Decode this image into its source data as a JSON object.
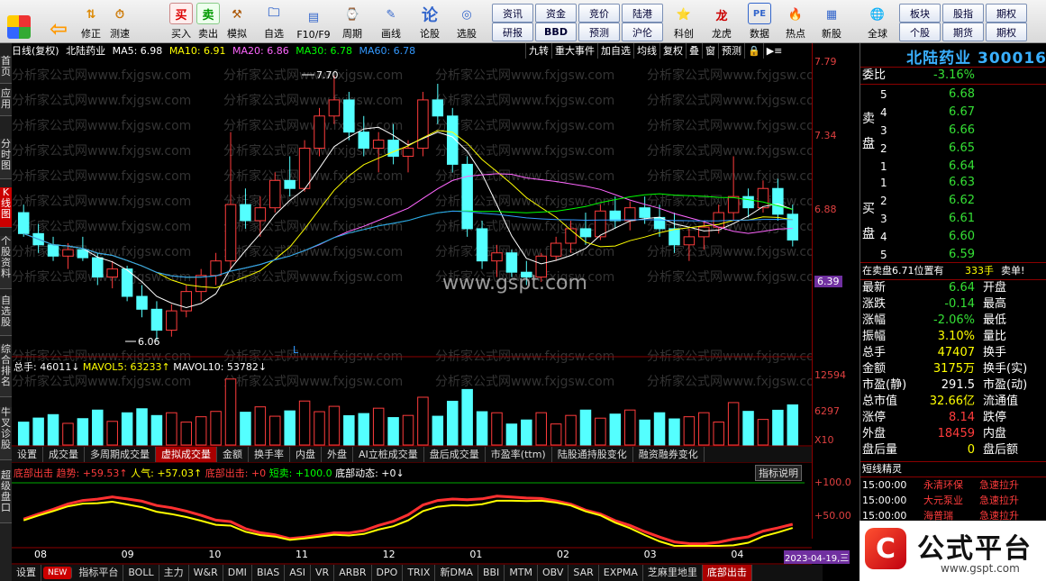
{
  "toolbar": {
    "buttons": [
      {
        "label": "",
        "icon": "grid-icon"
      },
      {
        "label": "",
        "icon": "back-arrow-icon"
      },
      {
        "label": "修正"
      },
      {
        "label": "测速"
      },
      {
        "label": "买入"
      },
      {
        "label": "卖出"
      },
      {
        "label": "模拟"
      },
      {
        "label": "自选"
      },
      {
        "label": "F10/F9"
      },
      {
        "label": "周期"
      },
      {
        "label": "画线"
      },
      {
        "label": "论股"
      },
      {
        "label": "选股"
      }
    ],
    "small_buttons": [
      "资讯",
      "资金",
      "竞价",
      "陆港",
      "研报",
      "BBD",
      "预测",
      "沪伦"
    ],
    "right_buttons": [
      {
        "label": "科创"
      },
      {
        "label": "龙虎"
      },
      {
        "label": "数据"
      },
      {
        "label": "热点"
      },
      {
        "label": "新股"
      },
      {
        "label": "全球"
      }
    ],
    "far_right": [
      "板块",
      "股指",
      "期权",
      "个股",
      "期货",
      "期权"
    ]
  },
  "left_tabs": [
    "首页",
    "应用",
    "分时图",
    "K线图",
    "个股资料",
    "自选股",
    "综合排名",
    "牛叉诊股",
    "超级盘口"
  ],
  "chart": {
    "info_title": "日线(复权)",
    "stock_name": "北陆药业",
    "ma_labels": [
      {
        "text": "MA5: 6.98",
        "color": "#ffffff"
      },
      {
        "text": "MA10: 6.91",
        "color": "#ffff00"
      },
      {
        "text": "MA20: 6.86",
        "color": "#ff66ff"
      },
      {
        "text": "MA30: 6.78",
        "color": "#00ff00"
      },
      {
        "text": "MA60: 6.78",
        "color": "#3399ff"
      }
    ],
    "top_right_tools": [
      "九转",
      "重大事件",
      "加自选",
      "均线",
      "复权",
      "叠",
      "窗",
      "预测"
    ],
    "price_axis": [
      "7.79",
      "7.34",
      "6.88",
      "6.39"
    ],
    "high_mark": "7.70",
    "low_mark": "6.06",
    "current_price_tag": "6.39",
    "watermark": "www.gspt.com",
    "bg_watermark": "分析家公式网www.fxjgsw.com",
    "volume_labels": [
      {
        "text": "总手: 46011↓",
        "color": "#ffffff"
      },
      {
        "text": "MAVOL5: 63233↑",
        "color": "#ffff00"
      },
      {
        "text": "MAVOL10: 53782↓",
        "color": "#ffffff"
      }
    ],
    "volume_axis": [
      "12594",
      "6297",
      "X10"
    ],
    "bottom_tabs": [
      "设置",
      "成交量",
      "多周期成交量",
      "虚拟成交量",
      "金额",
      "换手率",
      "内盘",
      "外盘",
      "AI立桩成交量",
      "盘后成交量",
      "市盈率(ttm)",
      "陆股通持股变化",
      "融资融券变化"
    ],
    "indicator_labels": [
      {
        "text": "底部出击 趋势: +59.53↑",
        "color": "#ff3c3c"
      },
      {
        "text": "人气: +57.03↑",
        "color": "#ffff00"
      },
      {
        "text": "底部出击: +0",
        "color": "#ff3c3c"
      },
      {
        "text": "短卖: +100.0",
        "color": "#00ff00"
      },
      {
        "text": "底部动态: +0↓",
        "color": "#ffffff"
      }
    ],
    "indicator_button": "指标说明",
    "indicator_axis": [
      "+100.0",
      "+50.00"
    ],
    "month_labels": [
      "08",
      "09",
      "10",
      "11",
      "12",
      "01",
      "02",
      "03",
      "04"
    ],
    "date_tag": "2023-04-19,三",
    "indicator_tabs": [
      "设置",
      "NEW",
      "指标平台",
      "BOLL",
      "主力",
      "W&R",
      "DMI",
      "BIAS",
      "ASI",
      "VR",
      "ARBR",
      "DPO",
      "TRIX",
      "新DMA",
      "BBI",
      "MTM",
      "OBV",
      "SAR",
      "EXPMA",
      "芝麻里地里",
      "底部出击"
    ]
  },
  "chart_data": {
    "type": "candlestick",
    "title": "北陆药业",
    "ylim": [
      6.0,
      7.79
    ],
    "candles": [
      [
        6.85,
        6.9,
        6.7,
        6.72
      ],
      [
        6.72,
        6.78,
        6.6,
        6.65
      ],
      [
        6.65,
        6.7,
        6.55,
        6.58
      ],
      [
        6.58,
        6.66,
        6.5,
        6.62
      ],
      [
        6.62,
        6.7,
        6.55,
        6.57
      ],
      [
        6.57,
        6.6,
        6.4,
        6.45
      ],
      [
        6.45,
        6.55,
        6.38,
        6.5
      ],
      [
        6.5,
        6.52,
        6.3,
        6.33
      ],
      [
        6.33,
        6.4,
        6.2,
        6.25
      ],
      [
        6.25,
        6.3,
        6.06,
        6.12
      ],
      [
        6.12,
        6.28,
        6.08,
        6.24
      ],
      [
        6.24,
        6.4,
        6.2,
        6.36
      ],
      [
        6.36,
        6.5,
        6.3,
        6.46
      ],
      [
        6.46,
        6.6,
        6.4,
        6.55
      ],
      [
        6.55,
        7.35,
        6.5,
        6.9
      ],
      [
        6.9,
        7.0,
        6.75,
        6.8
      ],
      [
        6.8,
        6.95,
        6.7,
        6.88
      ],
      [
        6.88,
        7.1,
        6.85,
        7.05
      ],
      [
        7.05,
        7.2,
        6.95,
        7.0
      ],
      [
        7.0,
        7.3,
        6.98,
        7.25
      ],
      [
        7.25,
        7.5,
        7.2,
        7.45
      ],
      [
        7.45,
        7.7,
        7.4,
        7.55
      ],
      [
        7.55,
        7.6,
        7.3,
        7.35
      ],
      [
        7.35,
        7.45,
        7.2,
        7.25
      ],
      [
        7.25,
        7.35,
        7.1,
        7.3
      ],
      [
        7.3,
        7.4,
        7.15,
        7.2
      ],
      [
        7.2,
        7.3,
        7.1,
        7.25
      ],
      [
        7.25,
        7.6,
        7.2,
        7.55
      ],
      [
        7.55,
        7.65,
        7.4,
        7.45
      ],
      [
        7.45,
        7.5,
        7.1,
        7.15
      ],
      [
        7.15,
        7.2,
        6.7,
        6.75
      ],
      [
        6.75,
        6.8,
        6.5,
        6.55
      ],
      [
        6.55,
        6.65,
        6.45,
        6.6
      ],
      [
        6.6,
        6.62,
        6.45,
        6.48
      ],
      [
        6.48,
        6.55,
        6.4,
        6.45
      ],
      [
        6.45,
        6.6,
        6.42,
        6.58
      ],
      [
        6.58,
        6.7,
        6.55,
        6.66
      ],
      [
        6.66,
        6.8,
        6.6,
        6.75
      ],
      [
        6.75,
        6.85,
        6.65,
        6.7
      ],
      [
        6.7,
        6.9,
        6.68,
        6.86
      ],
      [
        6.86,
        6.95,
        6.75,
        6.8
      ],
      [
        6.8,
        6.92,
        6.74,
        6.88
      ],
      [
        6.88,
        6.95,
        6.78,
        6.82
      ],
      [
        6.82,
        6.9,
        6.7,
        6.75
      ],
      [
        6.75,
        6.85,
        6.6,
        6.65
      ],
      [
        6.65,
        6.75,
        6.55,
        6.7
      ],
      [
        6.7,
        6.8,
        6.62,
        6.76
      ],
      [
        6.76,
        6.9,
        6.72,
        6.85
      ],
      [
        6.85,
        7.2,
        6.8,
        6.95
      ],
      [
        6.95,
        7.0,
        6.82,
        6.88
      ],
      [
        6.88,
        7.05,
        6.85,
        7.0
      ],
      [
        7.0,
        7.06,
        6.8,
        6.84
      ],
      [
        6.84,
        6.9,
        6.64,
        6.68
      ]
    ]
  },
  "quote": {
    "title": "北陆药业 300016",
    "weibi_label": "委比",
    "weibi_value": "-3.16%",
    "sell_label": "卖盘",
    "buy_label": "买盘",
    "asks": [
      {
        "lvl": "5",
        "price": "6.68"
      },
      {
        "lvl": "4",
        "price": "6.67"
      },
      {
        "lvl": "3",
        "price": "6.66"
      },
      {
        "lvl": "2",
        "price": "6.65"
      },
      {
        "lvl": "1",
        "price": "6.64"
      }
    ],
    "bids": [
      {
        "lvl": "1",
        "price": "6.63"
      },
      {
        "lvl": "2",
        "price": "6.62"
      },
      {
        "lvl": "3",
        "price": "6.61"
      },
      {
        "lvl": "4",
        "price": "6.60"
      },
      {
        "lvl": "5",
        "price": "6.59"
      }
    ],
    "notice": "在卖盘6.71位置有",
    "notice_vol": "333手",
    "notice_tail": "卖单!",
    "stats": [
      {
        "l": "最新",
        "v": "6.64",
        "c": "#35e035",
        "r": "开盘"
      },
      {
        "l": "涨跌",
        "v": "-0.14",
        "c": "#35e035",
        "r": "最高"
      },
      {
        "l": "涨幅",
        "v": "-2.06%",
        "c": "#35e035",
        "r": "最低"
      },
      {
        "l": "振幅",
        "v": "3.10%",
        "c": "#ffff00",
        "r": "量比"
      },
      {
        "l": "总手",
        "v": "47407",
        "c": "#ffff00",
        "r": "换手"
      },
      {
        "l": "金额",
        "v": "3175万",
        "c": "#ffff00",
        "r": "换手(实)"
      },
      {
        "l": "市盈(静)",
        "v": "291.5",
        "c": "#ffffff",
        "r": "市盈(动)"
      },
      {
        "l": "总市值",
        "v": "32.66亿",
        "c": "#ffff00",
        "r": "流通值"
      },
      {
        "l": "涨停",
        "v": "8.14",
        "c": "#ff3c3c",
        "r": "跌停"
      },
      {
        "l": "外盘",
        "v": "18459",
        "c": "#ff3c3c",
        "r": "内盘"
      },
      {
        "l": "盘后量",
        "v": "0",
        "c": "#ffff00",
        "r": "盘后额"
      }
    ],
    "short_title": "短线精灵",
    "short_items": [
      {
        "t": "15:00:00",
        "n": "永清环保",
        "e": "急速拉升"
      },
      {
        "t": "15:00:00",
        "n": "大元泵业",
        "e": "急速拉升"
      },
      {
        "t": "15:00:00",
        "n": "海普瑞",
        "e": "急速拉升"
      }
    ]
  },
  "logo": {
    "text": "公式平台",
    "url": "www.gspt.com"
  },
  "colors": {
    "up": "#ff3c3c",
    "down": "#54ffff",
    "bg": "#000000",
    "axis": "#8b0000"
  }
}
